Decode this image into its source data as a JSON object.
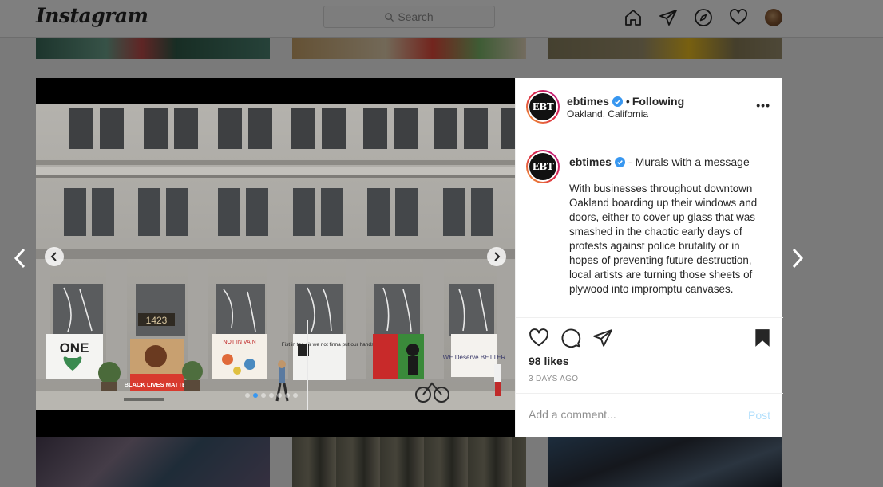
{
  "app": {
    "logo": "Instagram"
  },
  "search": {
    "placeholder": "Search"
  },
  "nav": {
    "icons": [
      "home-icon",
      "direct-icon",
      "explore-icon",
      "activity-heart-icon",
      "profile-avatar"
    ]
  },
  "post": {
    "username": "ebtimes",
    "avatar_text": "EBT",
    "separator": "•",
    "follow_status": "Following",
    "location": "Oakland, California",
    "more_label": "•••",
    "caption_title": "Murals with a message",
    "caption_dash": "-",
    "caption_body": "With businesses throughout downtown Oakland boarding up their windows and doors, either to cover up glass that was smashed in the chaotic early days of protests against police brutality or in hopes of preventing future destruction, local artists are turning those sheets of plywood into impromptu canvases.",
    "likes": "98 likes",
    "date": "3 DAYS AGO",
    "carousel": {
      "count": 7,
      "active_index": 1
    },
    "photo": {
      "building_number": "1423",
      "board_texts": [
        "ONE",
        "BLACK LIVES MATTER",
        "NOT IN VAIN",
        "Fist in the air we not finna put our hands up",
        "WE Deserve BETTER"
      ]
    }
  },
  "comment": {
    "placeholder": "Add a comment...",
    "post_label": "Post"
  },
  "colors": {
    "accent": "#3897f0",
    "post_disabled": "#b2dffc",
    "verified": "#3897f0"
  }
}
